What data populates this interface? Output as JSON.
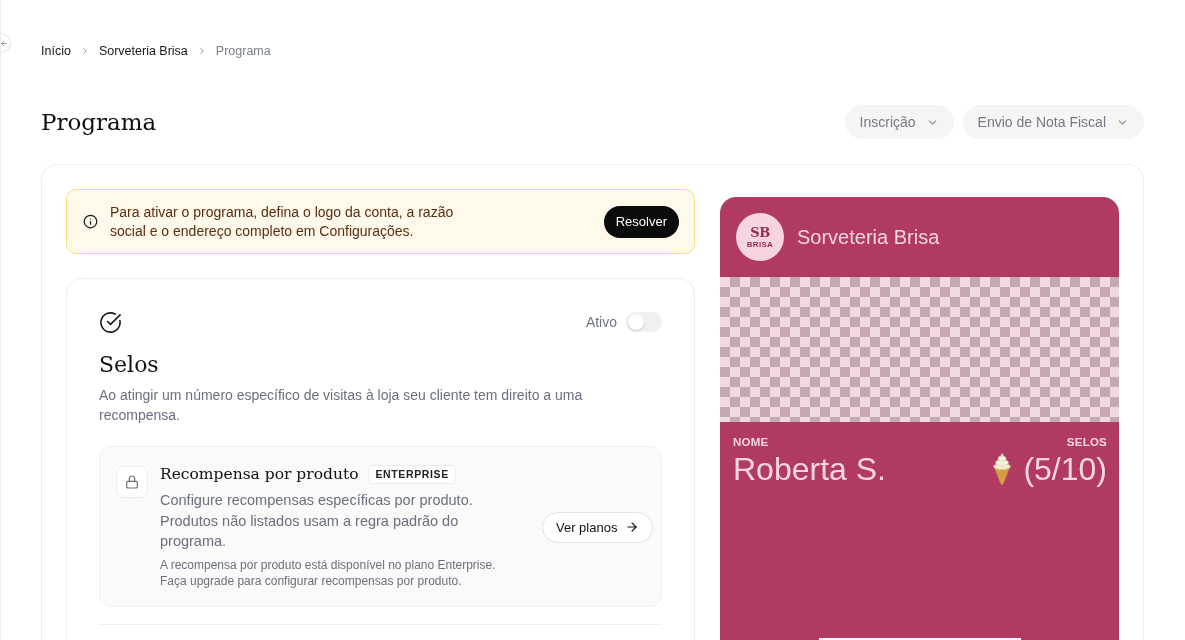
{
  "breadcrumb": [
    {
      "label": "Início",
      "current": false
    },
    {
      "label": "Sorveteria Brisa",
      "current": false
    },
    {
      "label": "Programa",
      "current": true
    }
  ],
  "header": {
    "title": "Programa",
    "menus": [
      {
        "label": "Inscrição"
      },
      {
        "label": "Envio de Nota Fiscal"
      }
    ]
  },
  "alert": {
    "message": "Para ativar o programa, defina o logo da conta, a razão social e o endereço completo em Configurações.",
    "action": "Resolver"
  },
  "program": {
    "status_label": "Ativo",
    "active": false,
    "title": "Selos",
    "description": "Ao atingir um número específico de visitas à loja seu cliente tem direito a uma recompensa.",
    "features": [
      {
        "title": "Recompensa por produto",
        "badge": "ENTERPRISE",
        "description": "Configure recompensas específicas por produto. Produtos não listados usam a regra padrão do programa.",
        "note": "A recompensa por produto está disponível no plano Enterprise. Faça upgrade para configurar recompensas por produto.",
        "action": "Ver planos"
      }
    ]
  },
  "card_preview": {
    "logo_initials": "SB",
    "logo_subtext": "BRISA",
    "store_name": "Sorveteria Brisa",
    "fields": [
      {
        "kind": "text",
        "label": "NOME",
        "value": "Roberta S."
      },
      {
        "kind": "stamps",
        "label": "SELOS",
        "value": "(5/10)"
      }
    ]
  }
}
